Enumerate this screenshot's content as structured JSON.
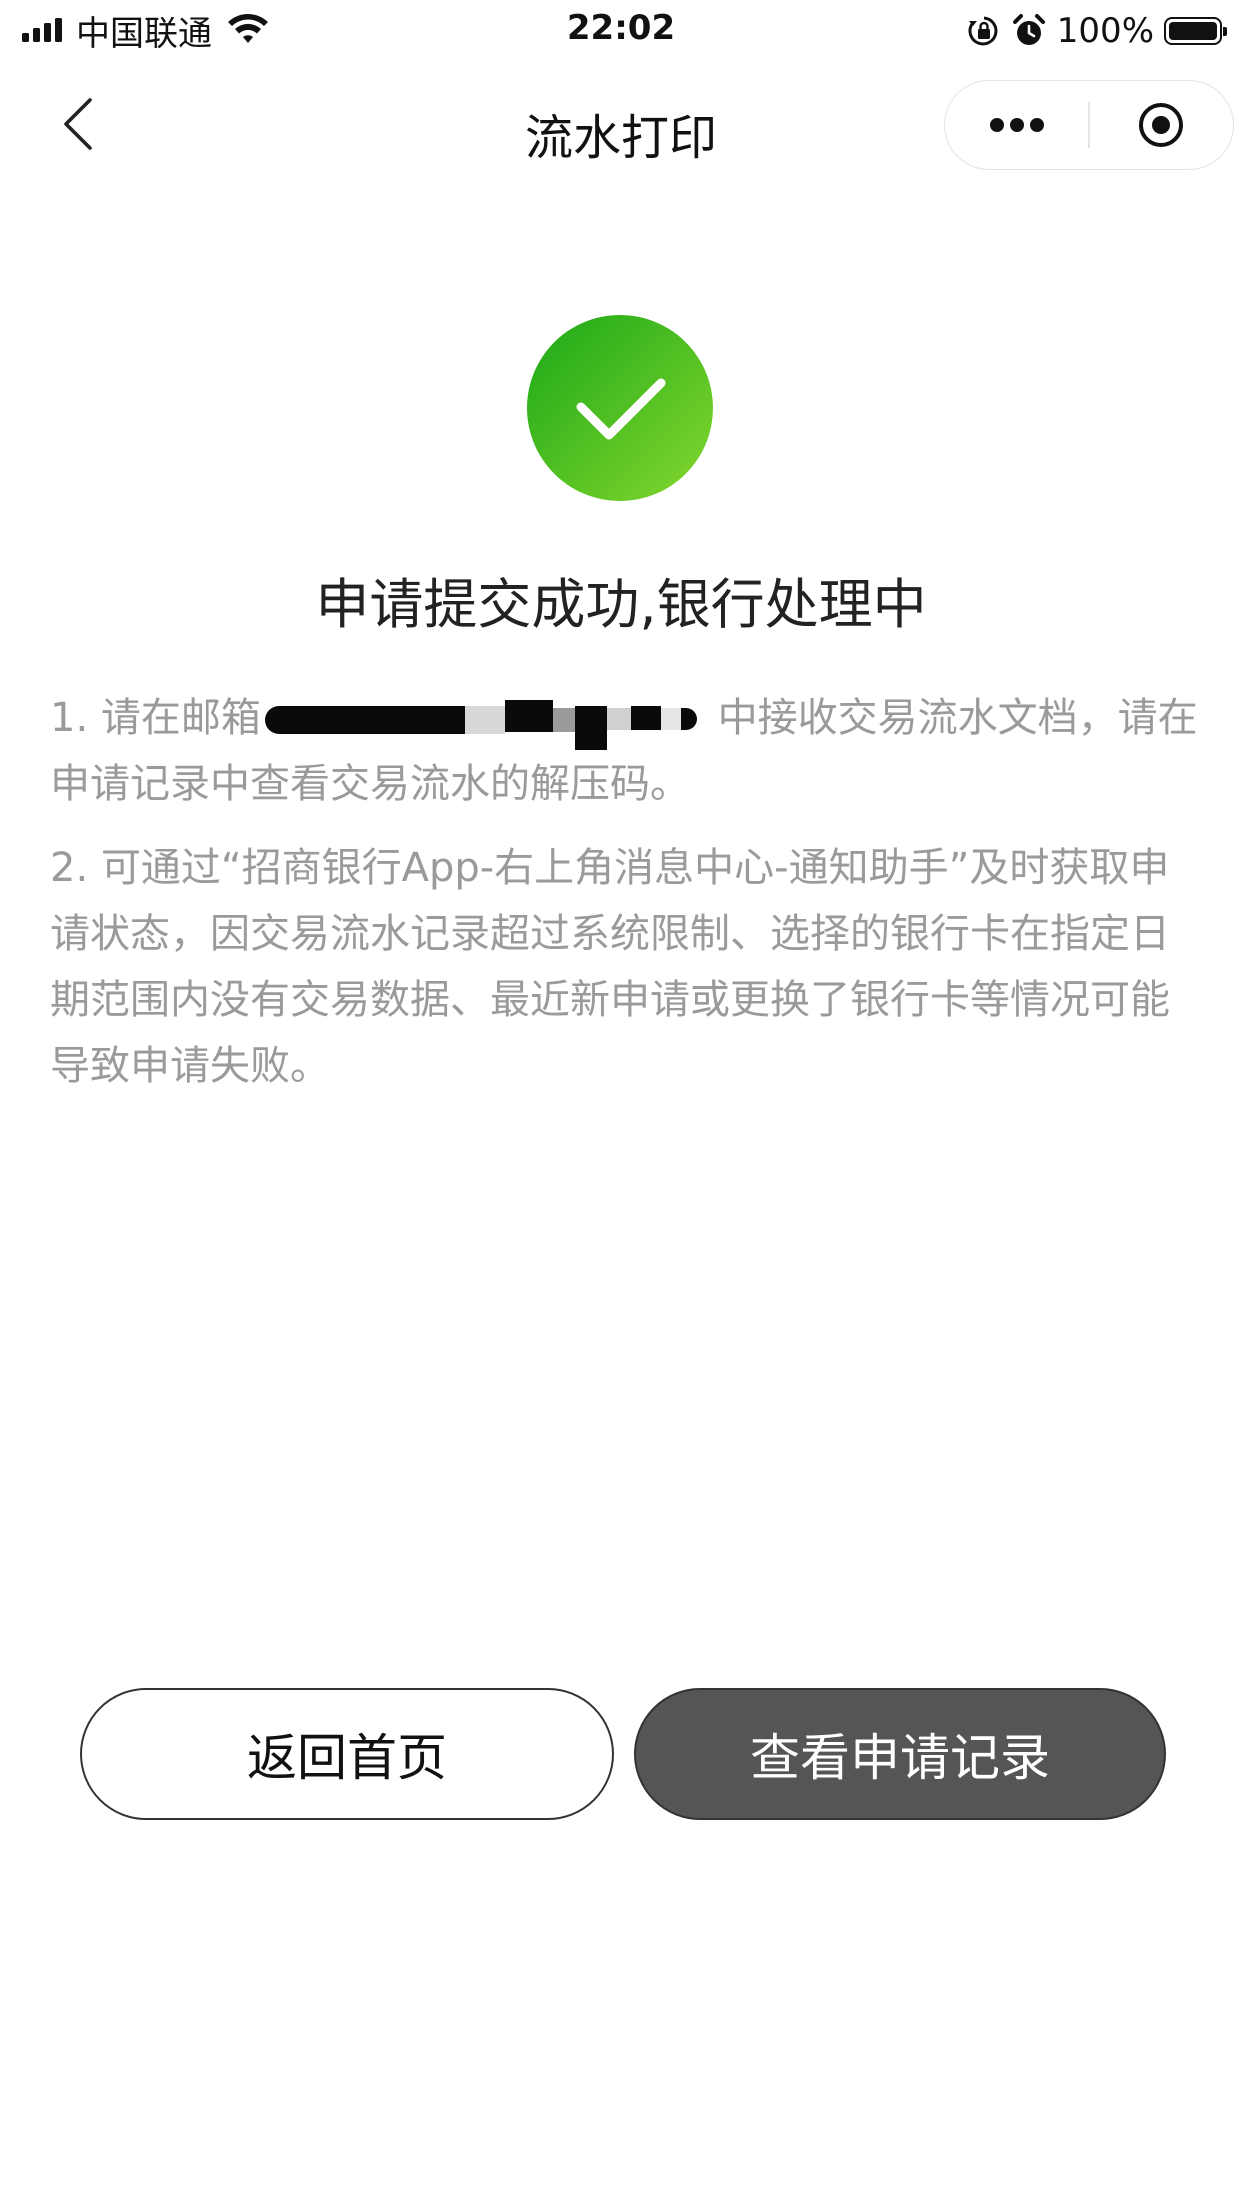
{
  "status_bar": {
    "carrier": "中国联通",
    "time": "22:02",
    "battery_percent": "100%"
  },
  "nav": {
    "title": "流水打印"
  },
  "result": {
    "headline": "申请提交成功,银行处理中",
    "note1_prefix": "1. 请在邮箱",
    "note1_suffix": " 中接收交易流水文档，请在申请记录中查看交易流水的解压码。",
    "note2": "2. 可通过“招商银行App-右上角消息中心-通知助手”及时获取申请状态，因交易流水记录超过系统限制、选择的银行卡在指定日期范围内没有交易数据、最近新申请或更换了银行卡等情况可能导致申请失败。"
  },
  "buttons": {
    "home_label": "返回首页",
    "records_label": "查看申请记录"
  },
  "colors": {
    "success_gradient_start": "#1aa818",
    "success_gradient_end": "#86d72e",
    "primary_button_bg": "#555555",
    "note_text": "#9a9a9a"
  },
  "icons": {
    "back": "chevron-left-icon",
    "more": "more-dots-icon",
    "close": "target-circle-icon",
    "success": "checkmark-icon"
  }
}
